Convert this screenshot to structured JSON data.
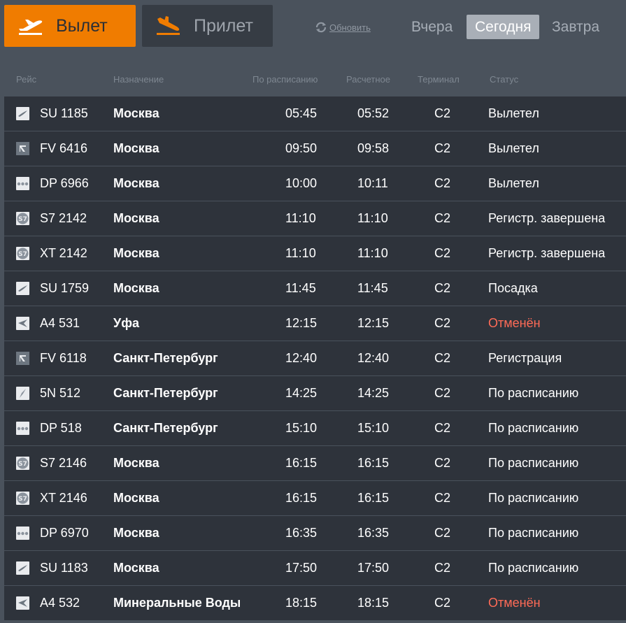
{
  "colors": {
    "accent": "#f07c00",
    "cancelled": "#ff6b57",
    "row_bg": "#2e333b",
    "page_bg": "#4a525c"
  },
  "tabs": {
    "departure": {
      "label": "Вылет",
      "icon": "plane-takeoff-icon",
      "active": true
    },
    "arrival": {
      "label": "Прилет",
      "icon": "plane-landing-icon",
      "active": false
    }
  },
  "refresh": {
    "label": "Обновить",
    "icon": "refresh-icon"
  },
  "days": {
    "yesterday": "Вчера",
    "today": "Сегодня",
    "tomorrow": "Завтра",
    "selected": "today"
  },
  "columns": {
    "flight": "Рейс",
    "destination": "Назначение",
    "scheduled": "По расписанию",
    "estimated": "Расчетное",
    "terminal": "Терминал",
    "status": "Статус"
  },
  "flights": [
    {
      "airline_icon": "aeroflot-logo-icon",
      "flight": "SU 1185",
      "destination": "Москва",
      "scheduled": "05:45",
      "estimated": "05:52",
      "terminal": "C2",
      "status": "Вылетел",
      "cancelled": false
    },
    {
      "airline_icon": "rossiya-logo-icon",
      "flight": "FV 6416",
      "destination": "Москва",
      "scheduled": "09:50",
      "estimated": "09:58",
      "terminal": "C2",
      "status": "Вылетел",
      "cancelled": false
    },
    {
      "airline_icon": "pobeda-logo-icon",
      "flight": "DP 6966",
      "destination": "Москва",
      "scheduled": "10:00",
      "estimated": "10:11",
      "terminal": "C2",
      "status": "Вылетел",
      "cancelled": false
    },
    {
      "airline_icon": "s7-logo-icon",
      "flight": "S7 2142",
      "destination": "Москва",
      "scheduled": "11:10",
      "estimated": "11:10",
      "terminal": "C2",
      "status": "Регистр. завершена",
      "cancelled": false
    },
    {
      "airline_icon": "s7-logo-icon",
      "flight": "XT 2142",
      "destination": "Москва",
      "scheduled": "11:10",
      "estimated": "11:10",
      "terminal": "C2",
      "status": "Регистр. завершена",
      "cancelled": false
    },
    {
      "airline_icon": "aeroflot-logo-icon",
      "flight": "SU 1759",
      "destination": "Москва",
      "scheduled": "11:45",
      "estimated": "11:45",
      "terminal": "C2",
      "status": "Посадка",
      "cancelled": false
    },
    {
      "airline_icon": "alrosa-logo-icon",
      "flight": "A4 531",
      "destination": "Уфа",
      "scheduled": "12:15",
      "estimated": "12:15",
      "terminal": "C2",
      "status": "Отменён",
      "cancelled": true
    },
    {
      "airline_icon": "rossiya-logo-icon",
      "flight": "FV 6118",
      "destination": "Санкт-Петербург",
      "scheduled": "12:40",
      "estimated": "12:40",
      "terminal": "C2",
      "status": "Регистрация",
      "cancelled": false
    },
    {
      "airline_icon": "nordstar-logo-icon",
      "flight": "5N 512",
      "destination": "Санкт-Петербург",
      "scheduled": "14:25",
      "estimated": "14:25",
      "terminal": "C2",
      "status": "По расписанию",
      "cancelled": false
    },
    {
      "airline_icon": "pobeda-logo-icon",
      "flight": "DP 518",
      "destination": "Санкт-Петербург",
      "scheduled": "15:10",
      "estimated": "15:10",
      "terminal": "C2",
      "status": "По расписанию",
      "cancelled": false
    },
    {
      "airline_icon": "s7-logo-icon",
      "flight": "S7 2146",
      "destination": "Москва",
      "scheduled": "16:15",
      "estimated": "16:15",
      "terminal": "C2",
      "status": "По расписанию",
      "cancelled": false
    },
    {
      "airline_icon": "s7-logo-icon",
      "flight": "XT 2146",
      "destination": "Москва",
      "scheduled": "16:15",
      "estimated": "16:15",
      "terminal": "C2",
      "status": "По расписанию",
      "cancelled": false
    },
    {
      "airline_icon": "pobeda-logo-icon",
      "flight": "DP 6970",
      "destination": "Москва",
      "scheduled": "16:35",
      "estimated": "16:35",
      "terminal": "C2",
      "status": "По расписанию",
      "cancelled": false
    },
    {
      "airline_icon": "aeroflot-logo-icon",
      "flight": "SU 1183",
      "destination": "Москва",
      "scheduled": "17:50",
      "estimated": "17:50",
      "terminal": "C2",
      "status": "По расписанию",
      "cancelled": false
    },
    {
      "airline_icon": "alrosa-logo-icon",
      "flight": "A4 532",
      "destination": "Минеральные Воды",
      "scheduled": "18:15",
      "estimated": "18:15",
      "terminal": "C2",
      "status": "Отменён",
      "cancelled": true
    }
  ]
}
